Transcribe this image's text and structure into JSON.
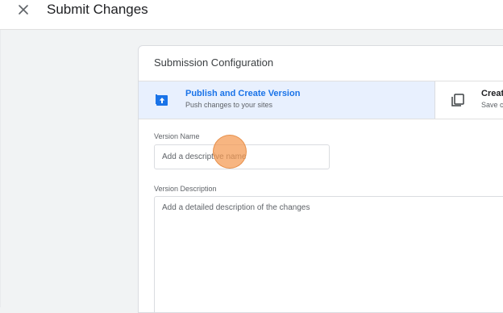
{
  "header": {
    "title": "Submit Changes",
    "close_icon": "close-icon"
  },
  "card": {
    "title": "Submission Configuration",
    "options": [
      {
        "title": "Publish and Create Version",
        "subtitle": "Push changes to your sites",
        "icon": "publish-icon",
        "selected": true
      },
      {
        "title": "Creat",
        "subtitle": "Save c",
        "icon": "copy-icon",
        "selected": false
      }
    ],
    "version_name": {
      "label": "Version Name",
      "placeholder": "Add a descriptive name",
      "value": ""
    },
    "version_description": {
      "label": "Version Description",
      "placeholder": "Add a detailed description of the changes",
      "value": ""
    }
  },
  "colors": {
    "accent": "#1a73e8",
    "selected_bg": "#e8f0fe",
    "click_marker": "#f49850"
  }
}
